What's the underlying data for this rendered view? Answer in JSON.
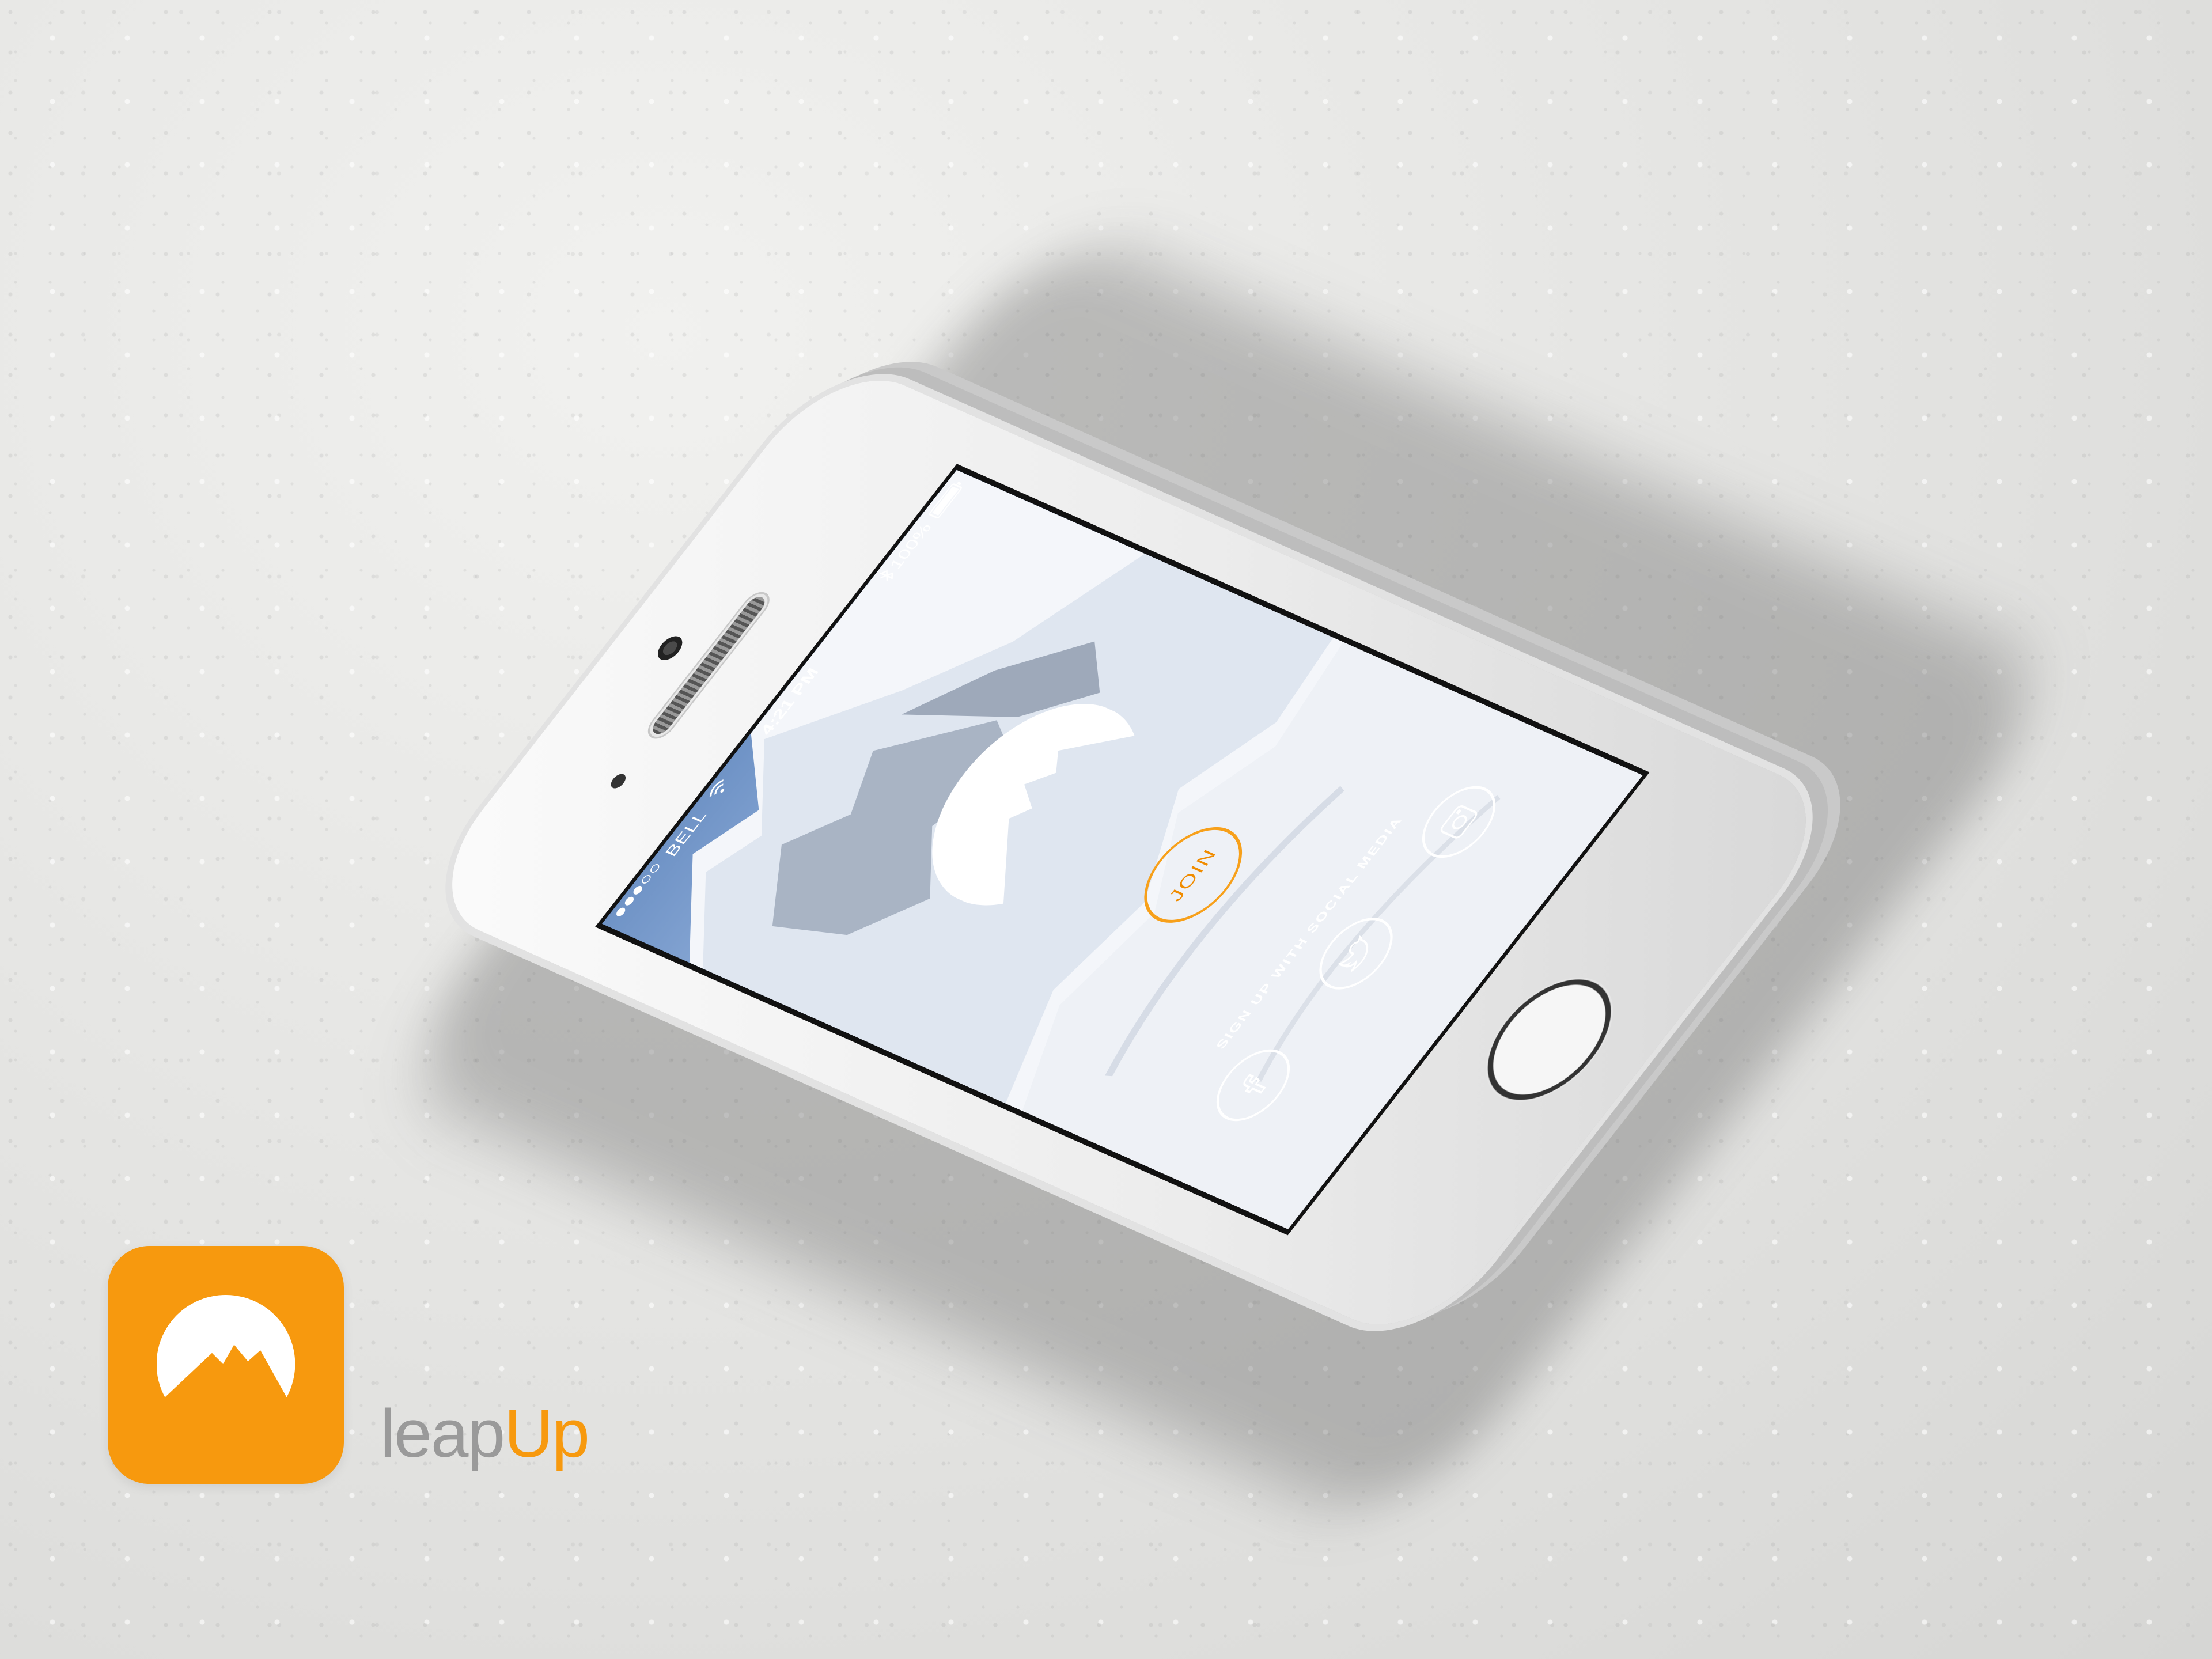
{
  "status_bar": {
    "carrier": "BELL",
    "time": "4:21 PM",
    "battery": "100%",
    "signal_bars_filled": 3,
    "signal_bars_total": 5
  },
  "main": {
    "join_label": "JOIN",
    "social_caption": "SIGN UP WITH SOCIAL MEDIA",
    "social": [
      {
        "name": "facebook",
        "icon": "facebook-icon"
      },
      {
        "name": "twitter",
        "icon": "twitter-icon"
      },
      {
        "name": "instagram",
        "icon": "instagram-icon"
      }
    ]
  },
  "brand": {
    "name_part1": "leap",
    "name_part2": "Up",
    "icon": "mountain-logo-icon"
  },
  "colors": {
    "accent": "#f7990e",
    "join_ring": "#f7a01a",
    "join_text": "#f08c00",
    "sky": "#6f93c6"
  }
}
